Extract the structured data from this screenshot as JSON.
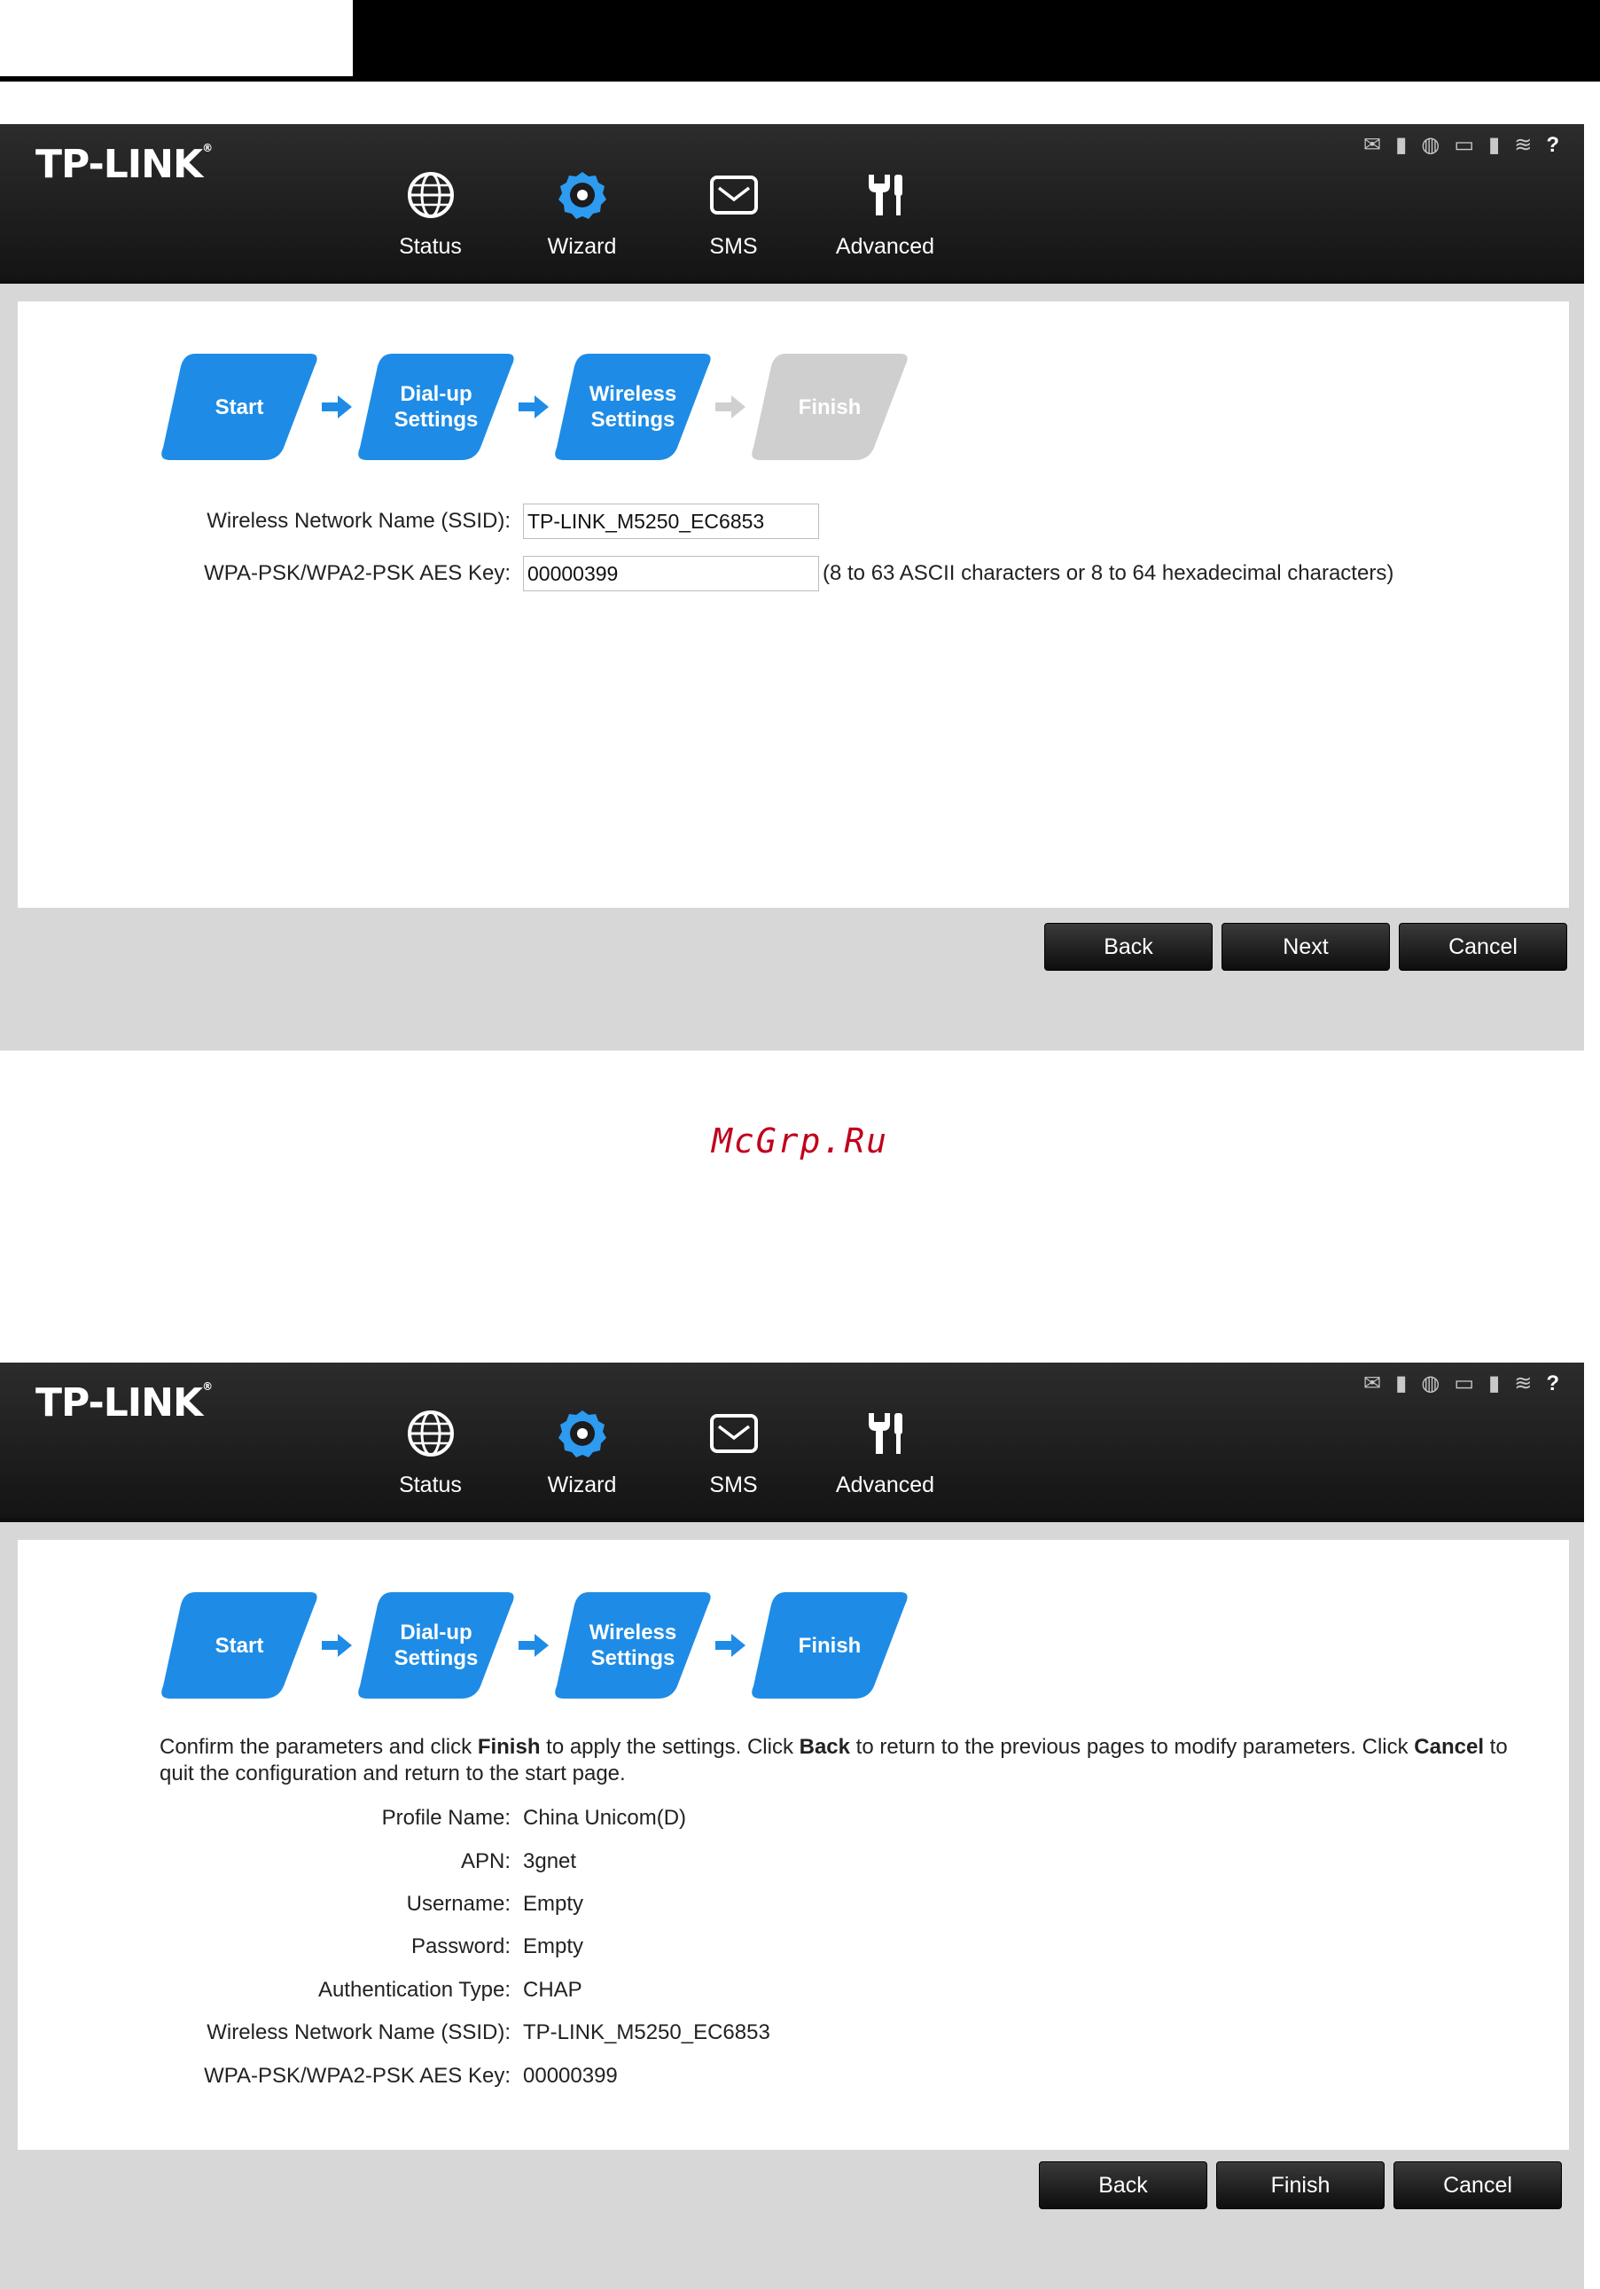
{
  "watermark": "McGrp.Ru",
  "brand": {
    "logo": "TP-LINK",
    "reg": "®"
  },
  "status_icons": [
    "mail-icon",
    "signal-icon",
    "globe-icon",
    "battery-icon",
    "sd-card-icon",
    "wifi-icon",
    "help-icon"
  ],
  "nav": [
    {
      "label": "Status",
      "icon": "globe-icon"
    },
    {
      "label": "Wizard",
      "icon": "wizard-gear-icon"
    },
    {
      "label": "SMS",
      "icon": "envelope-icon"
    },
    {
      "label": "Advanced",
      "icon": "tools-icon"
    }
  ],
  "colors": {
    "active_step": "#1e8ce6",
    "inactive_step": "#cfcfcf",
    "topbar": "#1c1c1c",
    "panel_bg": "#d7d7d7"
  },
  "screen1": {
    "steps": [
      {
        "label": "Start",
        "active": true
      },
      {
        "label": "Dial-up Settings",
        "active": true
      },
      {
        "label": "Wireless Settings",
        "active": true
      },
      {
        "label": "Finish",
        "active": false
      }
    ],
    "ssid_label": "Wireless Network Name (SSID):",
    "ssid_value": "TP-LINK_M5250_EC6853",
    "key_label": "WPA-PSK/WPA2-PSK AES Key:",
    "key_value": "00000399",
    "key_hint": "(8 to 63 ASCII characters or 8 to 64 hexadecimal characters)",
    "buttons": {
      "back": "Back",
      "next": "Next",
      "cancel": "Cancel"
    }
  },
  "screen2": {
    "steps": [
      {
        "label": "Start",
        "active": true
      },
      {
        "label": "Dial-up Settings",
        "active": true
      },
      {
        "label": "Wireless Settings",
        "active": true
      },
      {
        "label": "Finish",
        "active": true
      }
    ],
    "confirm": {
      "p1": "Confirm the parameters and click ",
      "b1": "Finish",
      "p2": " to apply the settings. Click ",
      "b2": "Back",
      "p3": " to return to the previous pages to modify parameters. Click ",
      "b3": "Cancel",
      "p4": " to quit the configuration and return to the start page."
    },
    "summary": [
      {
        "label": "Profile Name:",
        "value": "China Unicom(D)"
      },
      {
        "label": "APN:",
        "value": "3gnet"
      },
      {
        "label": "Username:",
        "value": "Empty"
      },
      {
        "label": "Password:",
        "value": "Empty"
      },
      {
        "label": "Authentication Type:",
        "value": "CHAP"
      },
      {
        "label": "Wireless Network Name (SSID):",
        "value": "TP-LINK_M5250_EC6853"
      },
      {
        "label": "WPA-PSK/WPA2-PSK AES Key:",
        "value": "00000399"
      }
    ],
    "buttons": {
      "back": "Back",
      "finish": "Finish",
      "cancel": "Cancel"
    }
  }
}
